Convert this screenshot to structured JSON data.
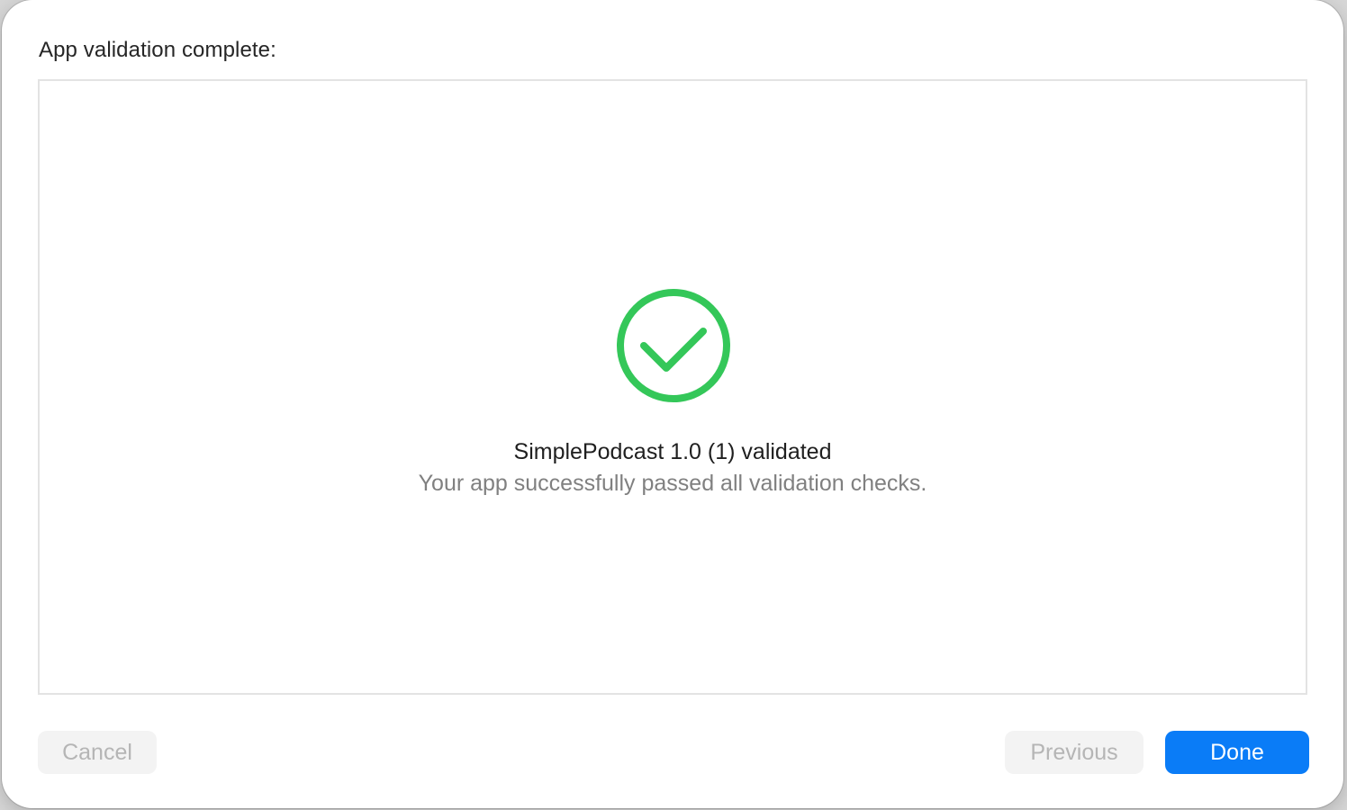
{
  "dialog": {
    "title": "App validation complete:",
    "status": {
      "icon": "checkmark-circle-icon",
      "icon_color": "#34c759",
      "title": "SimplePodcast 1.0 (1) validated",
      "subtitle": "Your app successfully passed all validation checks."
    },
    "buttons": {
      "cancel_label": "Cancel",
      "previous_label": "Previous",
      "done_label": "Done"
    },
    "colors": {
      "accent": "#0a7cf7",
      "disabled_text": "#b5b5b5"
    }
  }
}
